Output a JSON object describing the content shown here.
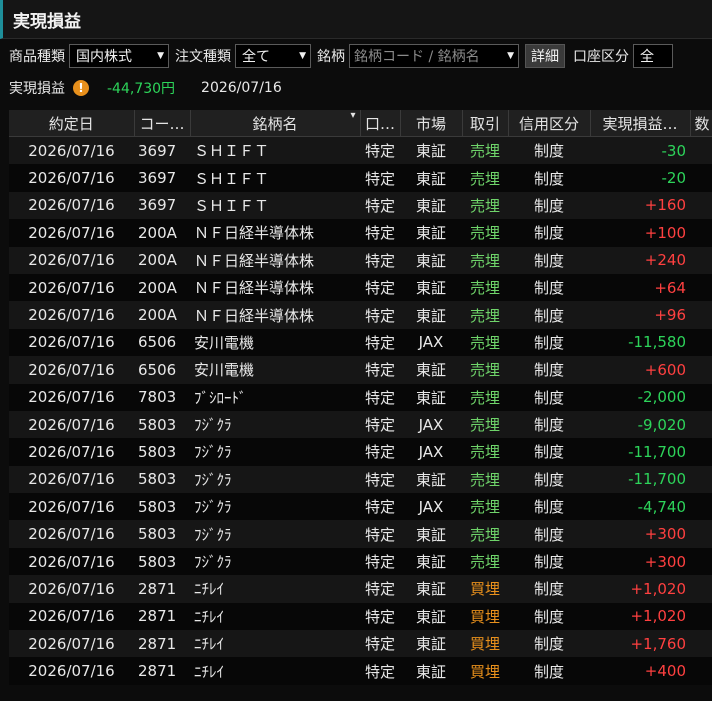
{
  "title": "実現損益",
  "filters": {
    "product_label": "商品種類",
    "product_value": "国内株式",
    "order_label": "注文種類",
    "order_value": "全て",
    "symbol_label": "銘柄",
    "symbol_placeholder": "銘柄コード / 銘柄名",
    "detail_button": "詳細",
    "account_label": "口座区分",
    "account_value": "全"
  },
  "summary": {
    "label": "実現損益",
    "value": "-44,730円",
    "date": "2026/07/16"
  },
  "table": {
    "headers": [
      "約定日",
      "コー…",
      "銘柄名",
      "口…",
      "市場",
      "取引",
      "信用区分",
      "実現損益…",
      "数"
    ],
    "rows": [
      {
        "date": "2026/07/16",
        "code": "3697",
        "name": "ＳＨＩＦＴ",
        "account": "特定",
        "market": "東証",
        "trade": "売埋",
        "credit": "制度",
        "pl": "-30",
        "dir": "sell",
        "sign": "neg"
      },
      {
        "date": "2026/07/16",
        "code": "3697",
        "name": "ＳＨＩＦＴ",
        "account": "特定",
        "market": "東証",
        "trade": "売埋",
        "credit": "制度",
        "pl": "-20",
        "dir": "sell",
        "sign": "neg"
      },
      {
        "date": "2026/07/16",
        "code": "3697",
        "name": "ＳＨＩＦＴ",
        "account": "特定",
        "market": "東証",
        "trade": "売埋",
        "credit": "制度",
        "pl": "+160",
        "dir": "sell",
        "sign": "pos"
      },
      {
        "date": "2026/07/16",
        "code": "200A",
        "name": "ＮＦ日経半導体株",
        "account": "特定",
        "market": "東証",
        "trade": "売埋",
        "credit": "制度",
        "pl": "+100",
        "dir": "sell",
        "sign": "pos"
      },
      {
        "date": "2026/07/16",
        "code": "200A",
        "name": "ＮＦ日経半導体株",
        "account": "特定",
        "market": "東証",
        "trade": "売埋",
        "credit": "制度",
        "pl": "+240",
        "dir": "sell",
        "sign": "pos"
      },
      {
        "date": "2026/07/16",
        "code": "200A",
        "name": "ＮＦ日経半導体株",
        "account": "特定",
        "market": "東証",
        "trade": "売埋",
        "credit": "制度",
        "pl": "+64",
        "dir": "sell",
        "sign": "pos"
      },
      {
        "date": "2026/07/16",
        "code": "200A",
        "name": "ＮＦ日経半導体株",
        "account": "特定",
        "market": "東証",
        "trade": "売埋",
        "credit": "制度",
        "pl": "+96",
        "dir": "sell",
        "sign": "pos"
      },
      {
        "date": "2026/07/16",
        "code": "6506",
        "name": "安川電機",
        "account": "特定",
        "market": "JAX",
        "trade": "売埋",
        "credit": "制度",
        "pl": "-11,580",
        "dir": "sell",
        "sign": "neg"
      },
      {
        "date": "2026/07/16",
        "code": "6506",
        "name": "安川電機",
        "account": "特定",
        "market": "東証",
        "trade": "売埋",
        "credit": "制度",
        "pl": "+600",
        "dir": "sell",
        "sign": "pos"
      },
      {
        "date": "2026/07/16",
        "code": "7803",
        "name": "ﾌﾞｼﾛｰﾄﾞ",
        "account": "特定",
        "market": "東証",
        "trade": "売埋",
        "credit": "制度",
        "pl": "-2,000",
        "dir": "sell",
        "sign": "neg"
      },
      {
        "date": "2026/07/16",
        "code": "5803",
        "name": "ﾌｼﾞｸﾗ",
        "account": "特定",
        "market": "JAX",
        "trade": "売埋",
        "credit": "制度",
        "pl": "-9,020",
        "dir": "sell",
        "sign": "neg"
      },
      {
        "date": "2026/07/16",
        "code": "5803",
        "name": "ﾌｼﾞｸﾗ",
        "account": "特定",
        "market": "JAX",
        "trade": "売埋",
        "credit": "制度",
        "pl": "-11,700",
        "dir": "sell",
        "sign": "neg"
      },
      {
        "date": "2026/07/16",
        "code": "5803",
        "name": "ﾌｼﾞｸﾗ",
        "account": "特定",
        "market": "東証",
        "trade": "売埋",
        "credit": "制度",
        "pl": "-11,700",
        "dir": "sell",
        "sign": "neg"
      },
      {
        "date": "2026/07/16",
        "code": "5803",
        "name": "ﾌｼﾞｸﾗ",
        "account": "特定",
        "market": "JAX",
        "trade": "売埋",
        "credit": "制度",
        "pl": "-4,740",
        "dir": "sell",
        "sign": "neg"
      },
      {
        "date": "2026/07/16",
        "code": "5803",
        "name": "ﾌｼﾞｸﾗ",
        "account": "特定",
        "market": "東証",
        "trade": "売埋",
        "credit": "制度",
        "pl": "+300",
        "dir": "sell",
        "sign": "pos"
      },
      {
        "date": "2026/07/16",
        "code": "5803",
        "name": "ﾌｼﾞｸﾗ",
        "account": "特定",
        "market": "東証",
        "trade": "売埋",
        "credit": "制度",
        "pl": "+300",
        "dir": "sell",
        "sign": "pos"
      },
      {
        "date": "2026/07/16",
        "code": "2871",
        "name": "ﾆﾁﾚｲ",
        "account": "特定",
        "market": "東証",
        "trade": "買埋",
        "credit": "制度",
        "pl": "+1,020",
        "dir": "buy",
        "sign": "pos"
      },
      {
        "date": "2026/07/16",
        "code": "2871",
        "name": "ﾆﾁﾚｲ",
        "account": "特定",
        "market": "東証",
        "trade": "買埋",
        "credit": "制度",
        "pl": "+1,020",
        "dir": "buy",
        "sign": "pos"
      },
      {
        "date": "2026/07/16",
        "code": "2871",
        "name": "ﾆﾁﾚｲ",
        "account": "特定",
        "market": "東証",
        "trade": "買埋",
        "credit": "制度",
        "pl": "+1,760",
        "dir": "buy",
        "sign": "pos"
      },
      {
        "date": "2026/07/16",
        "code": "2871",
        "name": "ﾆﾁﾚｲ",
        "account": "特定",
        "market": "東証",
        "trade": "買埋",
        "credit": "制度",
        "pl": "+400",
        "dir": "buy",
        "sign": "pos"
      }
    ]
  },
  "colors": {
    "accent": "#1e8f9a",
    "sell": "#6fd46a",
    "buy": "#e8901c",
    "profit": "#ff4040",
    "loss": "#2dd45a",
    "warning": "#e8901c"
  }
}
